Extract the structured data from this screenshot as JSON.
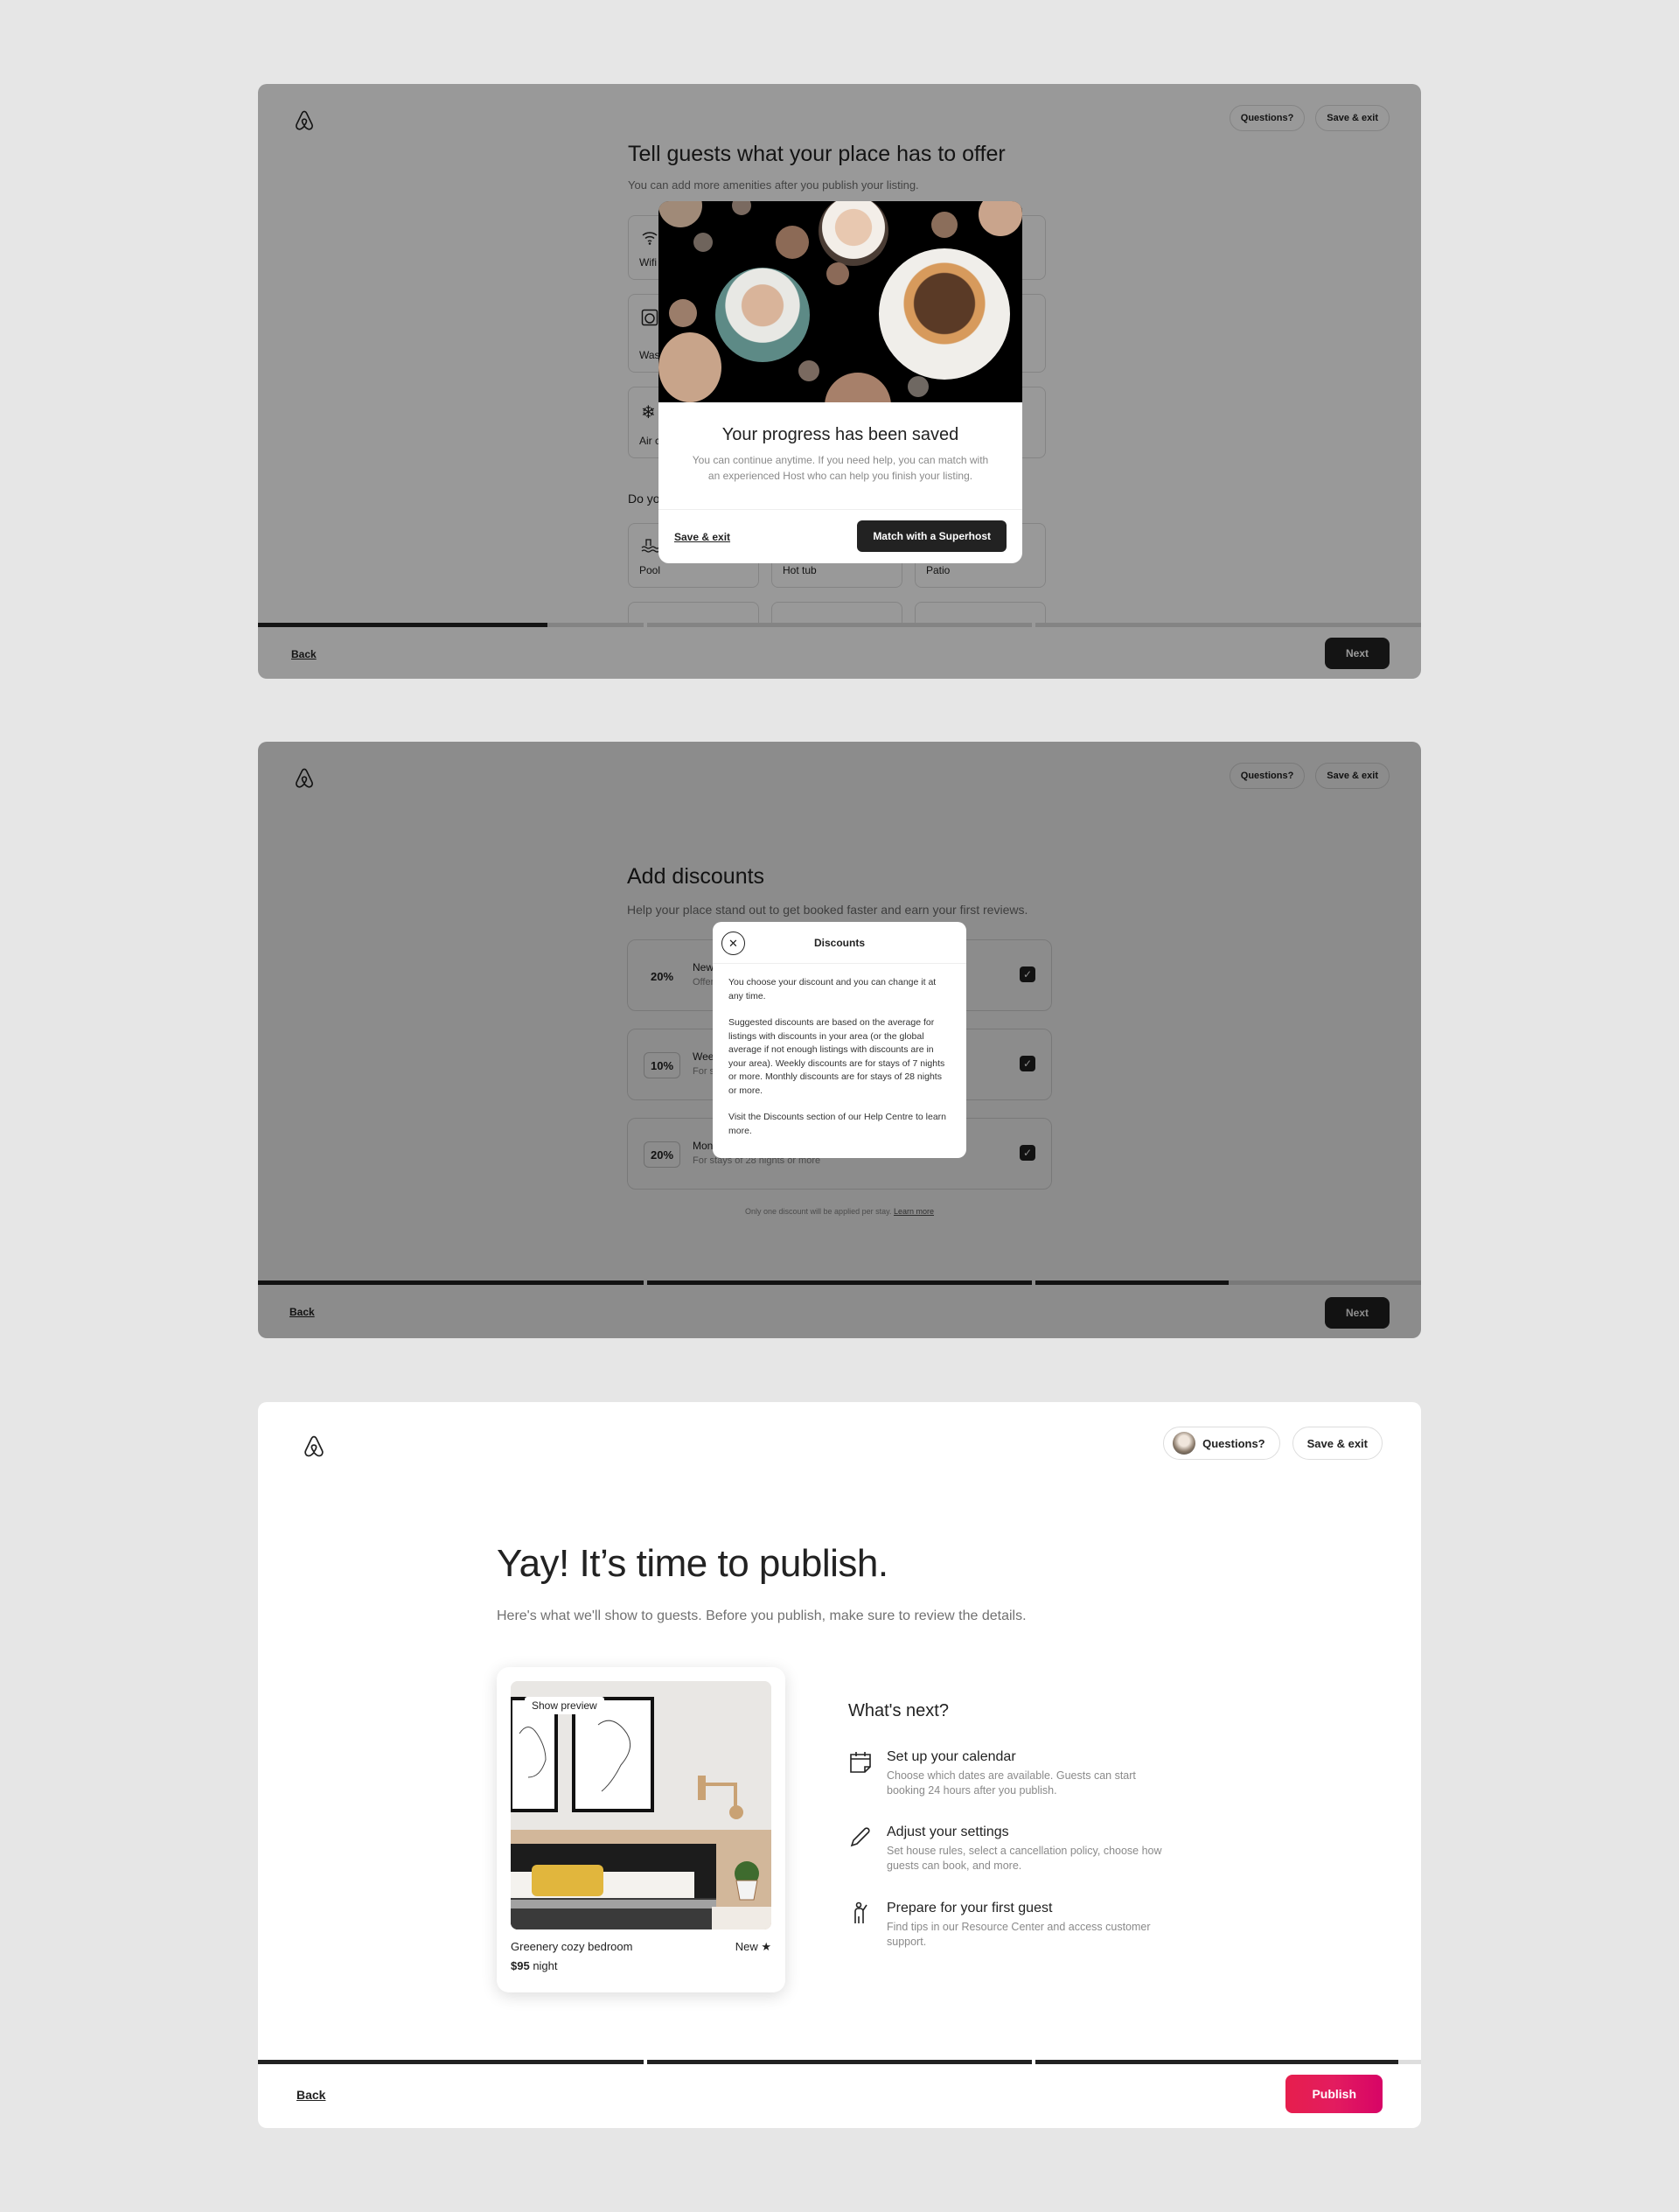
{
  "header": {
    "questions_label": "Questions?",
    "save_exit_label": "Save & exit"
  },
  "screen1": {
    "title": "Tell guests what your place has to offer",
    "subtitle": "You can add more amenities after you publish your listing.",
    "amenities_top": [
      {
        "label": "Wifi",
        "icon": "wifi-icon"
      },
      {
        "label": "Washer",
        "icon": "washer-icon"
      },
      {
        "label": "Air conditioning",
        "icon": "snowflake-icon"
      }
    ],
    "standout_question": "Do you have any standout amenities?",
    "amenities_standout": [
      {
        "label": "Pool",
        "icon": "pool-icon"
      },
      {
        "label": "Hot tub",
        "icon": "hot-tub-icon"
      },
      {
        "label": "Patio",
        "icon": "patio-icon"
      }
    ],
    "progress": [
      0.75,
      0,
      0
    ],
    "back_label": "Back",
    "next_label": "Next",
    "modal": {
      "title": "Your progress has been saved",
      "text": "You can continue anytime. If you need help, you can match with an experienced Host who can help you finish your listing.",
      "save_exit_label": "Save & exit",
      "match_label": "Match with a Superhost"
    }
  },
  "screen2": {
    "title": "Add discounts",
    "subtitle": "Help your place stand out to get booked faster and earn your first reviews.",
    "discounts": [
      {
        "percent": "20%",
        "name": "New listing promotion",
        "desc": "Offer 20% off your first 3 bookings",
        "checked": true
      },
      {
        "percent": "10%",
        "name": "Weekly discount",
        "desc": "For stays of 7 nights or more",
        "checked": true
      },
      {
        "percent": "20%",
        "name": "Monthly discount",
        "desc": "For stays of 28 nights or more",
        "checked": true
      }
    ],
    "note": "Only one discount will be applied per stay.",
    "learn_more": "Learn more",
    "progress": [
      1,
      1,
      0.5
    ],
    "back_label": "Back",
    "next_label": "Next",
    "modal": {
      "title": "Discounts",
      "paragraphs": [
        "You choose your discount and you can change it at any time.",
        "Suggested discounts are based on the average for listings with discounts in your area (or the global average if not enough listings with discounts are in your area). Weekly discounts are for stays of 7 nights or more. Monthly discounts are for stays of 28 nights or more.",
        "Visit the Discounts section of our Help Centre to learn more."
      ]
    }
  },
  "screen3": {
    "title": "Yay! It’s time to publish.",
    "subtitle": "Here's what we'll show to guests. Before you publish, make sure to review the details.",
    "listing": {
      "preview_label": "Show preview",
      "name": "Greenery cozy bedroom",
      "rating": "New ★",
      "price": "$95",
      "price_unit": " night"
    },
    "whats_next": "What's next?",
    "steps": [
      {
        "title": "Set up your calendar",
        "desc": "Choose which dates are available. Guests can start booking 24 hours after you publish.",
        "icon": "calendar-icon"
      },
      {
        "title": "Adjust your settings",
        "desc": "Set house rules, select a cancellation policy, choose how guests can book, and more.",
        "icon": "pencil-icon"
      },
      {
        "title": "Prepare for your first guest",
        "desc": "Find tips in our Resource Center and access customer support.",
        "icon": "guest-icon"
      }
    ],
    "progress": [
      1,
      1,
      0.94
    ],
    "back_label": "Back",
    "publish_label": "Publish",
    "publish_color": "#e31c5f"
  }
}
